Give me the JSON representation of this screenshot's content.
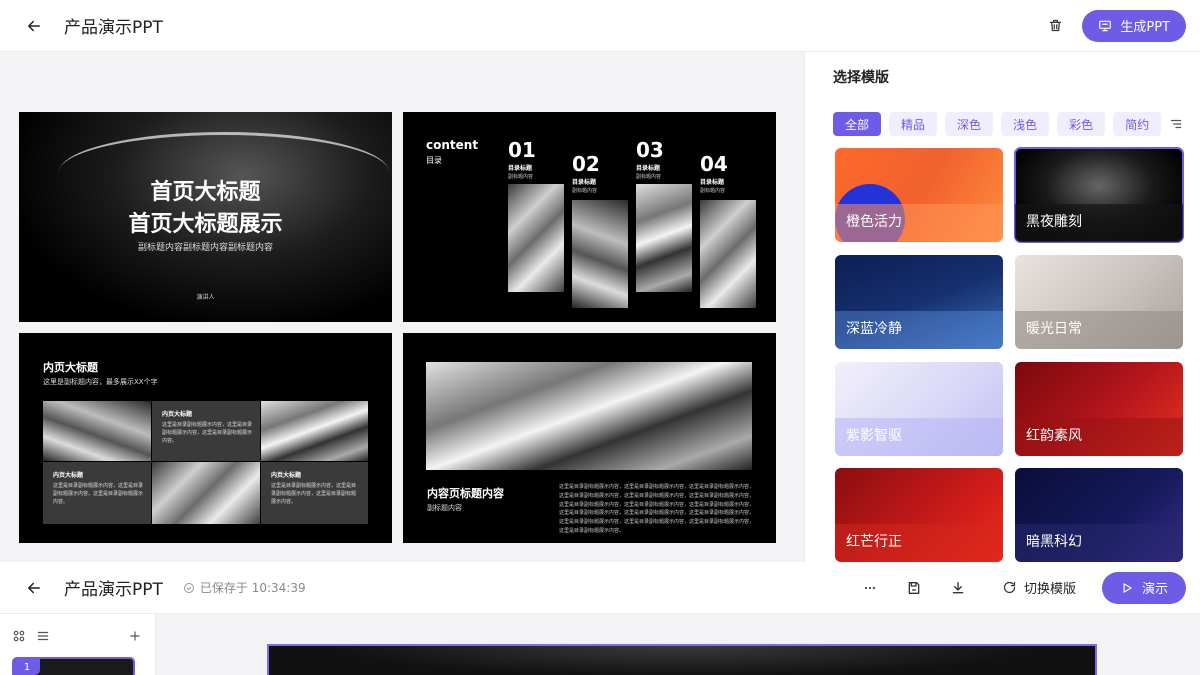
{
  "header": {
    "title": "产品演示PPT",
    "generate_label": "生成PPT"
  },
  "slides": {
    "cover": {
      "title_line1": "首页大标题",
      "title_line2": "首页大标题展示",
      "subtitle": "副标题内容副标题内容副标题内容",
      "presenter": "演讲人"
    },
    "toc": {
      "heading_en": "content",
      "heading_cn": "目录",
      "items": [
        {
          "num": "01",
          "label": "目录标题",
          "sub": "副标题内容"
        },
        {
          "num": "02",
          "label": "目录标题",
          "sub": "副标题内容"
        },
        {
          "num": "03",
          "label": "目录标题",
          "sub": "副标题内容"
        },
        {
          "num": "04",
          "label": "目录标题",
          "sub": "副标题内容"
        }
      ]
    },
    "inner": {
      "title": "内页大标题",
      "desc": "这里是副标题内容，最多展示XX个字",
      "cell_title": "内页大标题",
      "cell_text": "这里是目录副标题展示内容，这里是目录副标题展示内容，这里是目录副标题展示内容。"
    },
    "content": {
      "title": "内容页标题内容",
      "subtitle": "副标题内容",
      "body": "这里是目录副标题展示内容，这里是目录副标题展示内容，这里是目录副标题展示内容，这里是目录副标题展示内容，这里是目录副标题展示内容，这里是目录副标题展示内容，这里是目录副标题展示内容，这里是目录副标题展示内容，这里是目录副标题展示内容，这里是目录副标题展示内容，这里是目录副标题展示内容，这里是目录副标题展示内容，这里是目录副标题展示内容，这里是目录副标题展示内容，这里是目录副标题展示内容，这里是目录副标题展示内容。"
    }
  },
  "template_panel": {
    "title": "选择模版",
    "filters": [
      "全部",
      "精品",
      "深色",
      "浅色",
      "彩色",
      "简约"
    ],
    "active_filter": "全部",
    "templates": [
      {
        "name": "橙色活力",
        "color": "#f0612e"
      },
      {
        "name": "黑夜雕刻",
        "color": "#111111",
        "selected": true
      },
      {
        "name": "深蓝冷静",
        "color": "#16306e"
      },
      {
        "name": "暖光日常",
        "color": "#c9c3bd"
      },
      {
        "name": "紫影智驱",
        "color": "#d8d6f7"
      },
      {
        "name": "红韵素风",
        "color": "#b0131a"
      },
      {
        "name": "红芒行正",
        "color": "#c11818"
      },
      {
        "name": "暗黑科幻",
        "color": "#141a5a"
      }
    ]
  },
  "editor_bar": {
    "title": "产品演示PPT",
    "saved_text": "已保存于 10:34:39",
    "switch_label": "切换模版",
    "present_label": "演示"
  },
  "thumbnails": {
    "current_number": "1"
  },
  "colors": {
    "accent": "#6e5ce6"
  }
}
